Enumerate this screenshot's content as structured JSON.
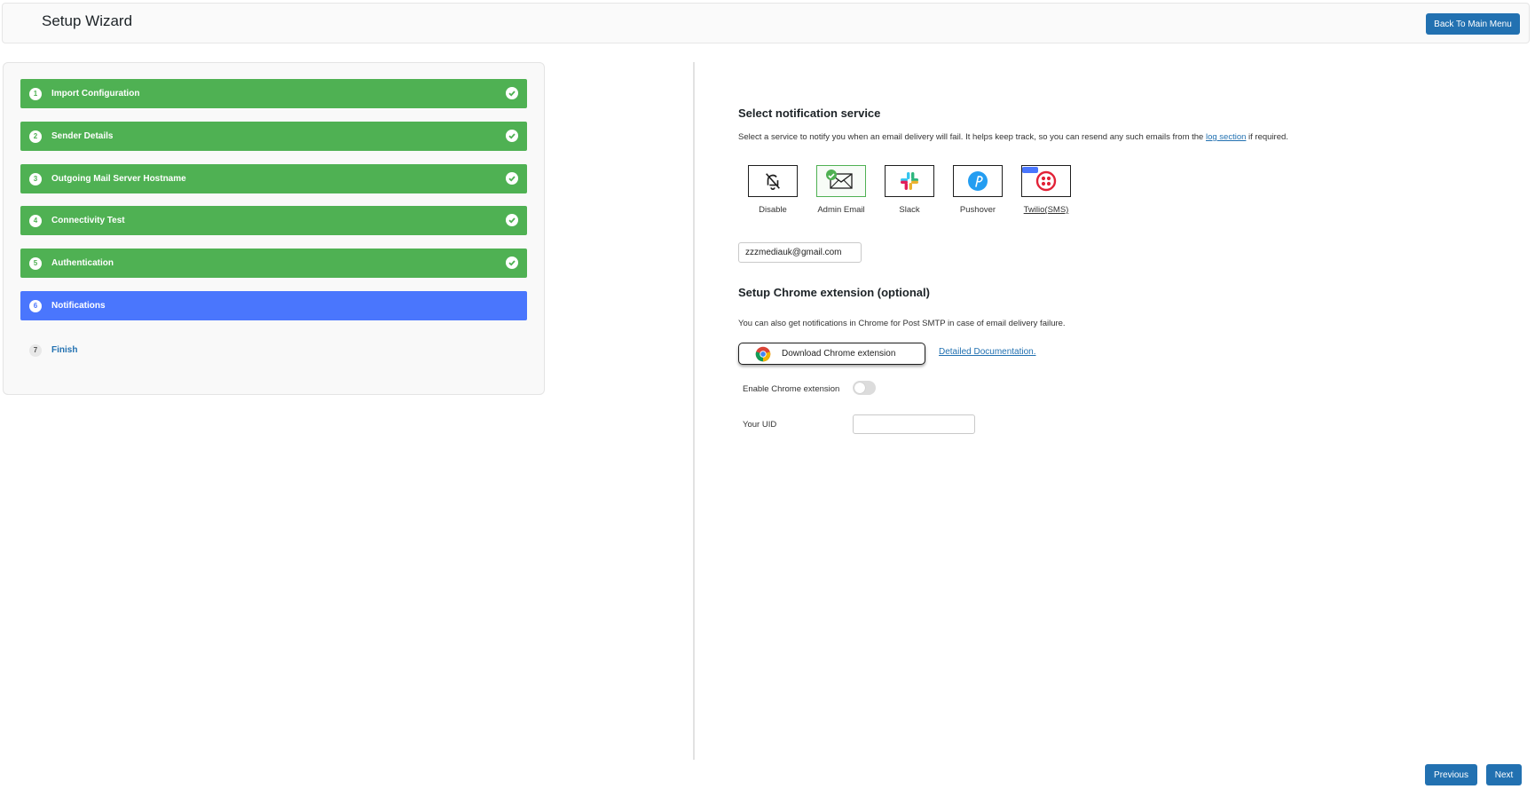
{
  "header": {
    "title": "Setup Wizard",
    "back_label": "Back To Main Menu"
  },
  "steps": [
    {
      "num": "1",
      "label": "Import Configuration",
      "state": "done"
    },
    {
      "num": "2",
      "label": "Sender Details",
      "state": "done"
    },
    {
      "num": "3",
      "label": "Outgoing Mail Server Hostname",
      "state": "done"
    },
    {
      "num": "4",
      "label": "Connectivity Test",
      "state": "done"
    },
    {
      "num": "5",
      "label": "Authentication",
      "state": "done"
    },
    {
      "num": "6",
      "label": "Notifications",
      "state": "active"
    },
    {
      "num": "7",
      "label": "Finish",
      "state": "pending"
    }
  ],
  "notification": {
    "heading": "Select notification service",
    "desc_before": "Select a service to notify you when an email delivery will fail. It helps keep track, so you can resend any such emails from the ",
    "desc_link": "log section",
    "desc_after": " if required.",
    "services": [
      {
        "name": "Disable",
        "icon": "bell-off-icon",
        "selected": false,
        "link": false
      },
      {
        "name": "Admin Email",
        "icon": "envelope-icon",
        "selected": true,
        "link": false
      },
      {
        "name": "Slack",
        "icon": "slack-icon",
        "selected": false,
        "link": false
      },
      {
        "name": "Pushover",
        "icon": "pushover-icon",
        "selected": false,
        "link": false
      },
      {
        "name": "Twilio(SMS)",
        "icon": "twilio-icon",
        "selected": false,
        "link": true
      }
    ],
    "email_value": "zzzmediauk@gmail.com"
  },
  "chrome": {
    "heading": "Setup Chrome extension (optional)",
    "desc": "You can also get notifications in Chrome for Post SMTP in case of email delivery failure.",
    "download_label": "Download Chrome extension",
    "doc_link": "Detailed Documentation.",
    "enable_label": "Enable Chrome extension",
    "enabled": false,
    "uid_label": "Your UID",
    "uid_value": ""
  },
  "footer": {
    "previous_label": "Previous",
    "next_label": "Next"
  },
  "colors": {
    "done_green": "#4fb153",
    "active_blue": "#4a76fd",
    "button_blue": "#2271b1"
  }
}
